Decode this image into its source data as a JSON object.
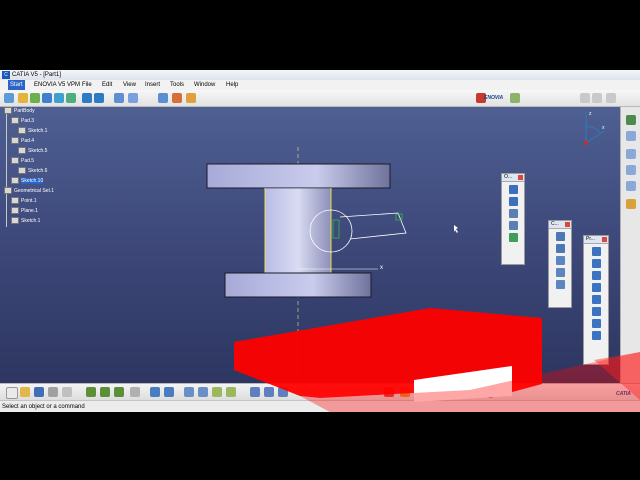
{
  "window": {
    "title": "CATIA V5 - [Part1]"
  },
  "menu": [
    "Start",
    "ENOVIA V5 VPM",
    "File",
    "Edit",
    "View",
    "Insert",
    "Tools",
    "Window",
    "Help"
  ],
  "tree": [
    {
      "label": "PartBody",
      "level": 1
    },
    {
      "label": "Pad.3",
      "level": 2
    },
    {
      "label": "Sketch.1",
      "level": 3
    },
    {
      "label": "Pad.4",
      "level": 2
    },
    {
      "label": "Sketch.5",
      "level": 3
    },
    {
      "label": "Pad.5",
      "level": 2
    },
    {
      "label": "Sketch.6",
      "level": 3
    },
    {
      "label": "Sketch.10",
      "level": 2,
      "selected": true
    },
    {
      "label": "Geometrical Set.1",
      "level": 1
    },
    {
      "label": "Point.1",
      "level": 2
    },
    {
      "label": "Plane.1",
      "level": 2
    },
    {
      "label": "Sketch.1",
      "level": 2
    }
  ],
  "palettes": {
    "profile": {
      "title": "Pr..."
    },
    "operation": {
      "title": "O..."
    },
    "constraint": {
      "title": "C..."
    }
  },
  "status": {
    "message": "Select an object or a command"
  },
  "brand": {
    "top": "ENOVIA",
    "bottom": "CATIA"
  },
  "compass_labels": {
    "x": "x",
    "y": "y",
    "z": "z"
  },
  "colors": {
    "viewport_top": "#4e5f92",
    "viewport_bottom": "#2d3660",
    "selection": "#2a64c6",
    "overlay_red": "#ff0000"
  }
}
